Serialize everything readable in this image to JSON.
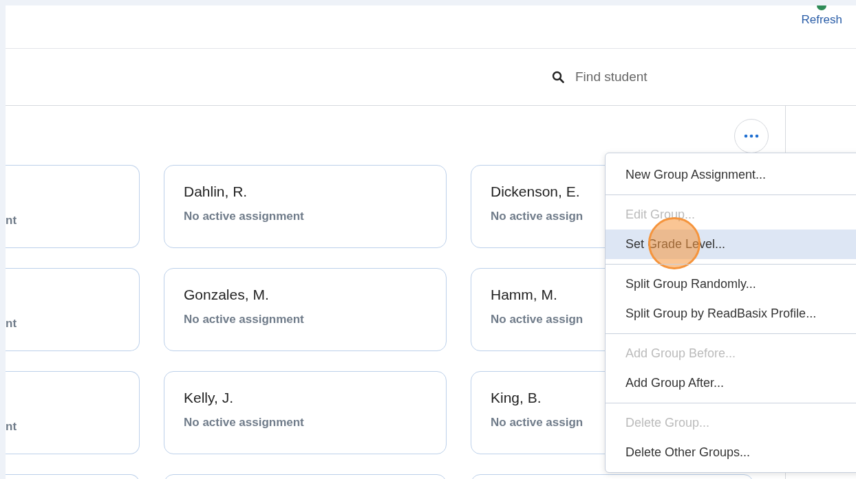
{
  "header": {
    "refresh": "Refresh"
  },
  "search": {
    "placeholder": "Find student"
  },
  "grid": {
    "rows": [
      {
        "cards": [
          {
            "status": "nt"
          },
          {
            "name": "Dahlin, R.",
            "status": "No active assignment"
          },
          {
            "name": "Dickenson, E.",
            "status": "No active assign"
          }
        ]
      },
      {
        "cards": [
          {
            "status": "nt"
          },
          {
            "name": "Gonzales, M.",
            "status": "No active assignment"
          },
          {
            "name": "Hamm, M.",
            "status": "No active assign"
          }
        ]
      },
      {
        "cards": [
          {
            "status": "nt"
          },
          {
            "name": "Kelly, J.",
            "status": "No active assignment"
          },
          {
            "name": "King, B.",
            "status": "No active assign"
          }
        ]
      }
    ]
  },
  "menu": {
    "groups": [
      {
        "items": [
          {
            "label": "New Group Assignment...",
            "disabled": false,
            "selected": false
          }
        ]
      },
      {
        "items": [
          {
            "label": "Edit Group...",
            "disabled": true,
            "selected": false
          },
          {
            "label": "Set Grade Level...",
            "disabled": false,
            "selected": true
          }
        ]
      },
      {
        "items": [
          {
            "label": "Split Group Randomly...",
            "disabled": false,
            "selected": false
          },
          {
            "label": "Split Group by ReadBasix Profile...",
            "disabled": false,
            "selected": false
          }
        ]
      },
      {
        "items": [
          {
            "label": "Add Group Before...",
            "disabled": true,
            "selected": false
          },
          {
            "label": "Add Group After...",
            "disabled": false,
            "selected": false
          }
        ]
      },
      {
        "items": [
          {
            "label": "Delete Group...",
            "disabled": true,
            "selected": false
          },
          {
            "label": "Delete Other Groups...",
            "disabled": false,
            "selected": false
          }
        ]
      }
    ]
  }
}
